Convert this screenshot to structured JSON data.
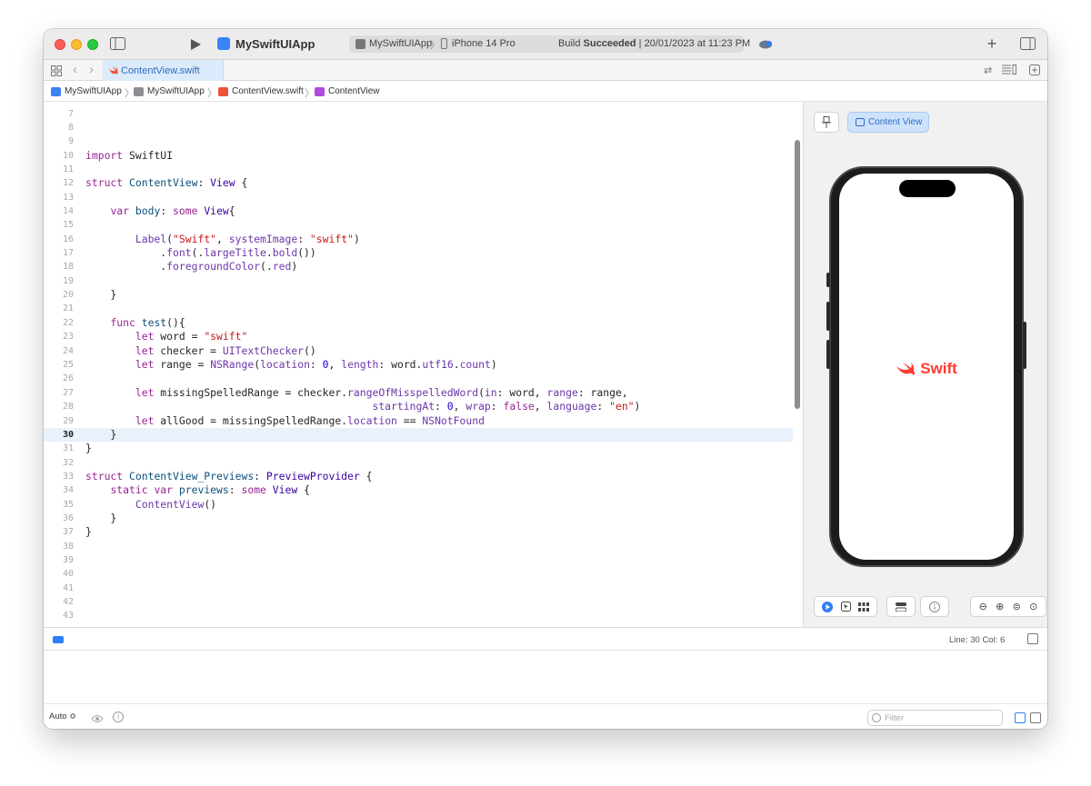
{
  "titlebar": {
    "app_name": "MySwiftUIApp",
    "scheme_target": "MySwiftUIApp",
    "device": "iPhone 14 Pro",
    "build_prefix": "Build ",
    "build_state": "Succeeded",
    "build_info": " | 20/01/2023 at 11:23 PM"
  },
  "tabs": [
    {
      "label": "ContentView.swift"
    }
  ],
  "breadcrumb": [
    "MySwiftUIApp",
    "MySwiftUIApp",
    "ContentView.swift",
    "ContentView"
  ],
  "editor": {
    "line_numbers": [
      "7",
      "8",
      "9",
      "10",
      "11",
      "12",
      "13",
      "14",
      "15",
      "16",
      "17",
      "18",
      "19",
      "20",
      "21",
      "22",
      "23",
      "24",
      "25",
      "26",
      "27",
      "28",
      "29",
      "30",
      "31",
      "32",
      "33",
      "34",
      "35",
      "36",
      "37",
      "38",
      "39",
      "40",
      "41",
      "42",
      "43"
    ],
    "current_line": "30"
  },
  "canvas": {
    "variant_label": "Content View",
    "preview_label": "Swift",
    "accent": "#ff3b30"
  },
  "status": {
    "line_col": "Line: 30  Col: 6"
  },
  "bottom": {
    "auto_label": "Auto ≎",
    "filter_placeholder": "Filter"
  }
}
